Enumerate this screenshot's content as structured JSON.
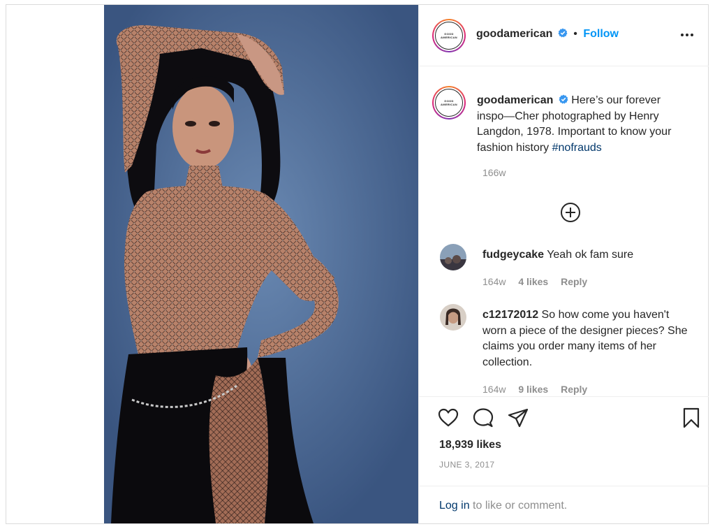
{
  "post": {
    "author": "goodamerican",
    "avatar_logo_line1": "GOOD",
    "avatar_logo_line2": "AMERICAN",
    "follow_label": "Follow",
    "separator": "•",
    "caption": "Here’s our forever inspo—Cher photographed by Henry Langdon, 1978. Important to know your fashion history",
    "hashtag": "#nofrauds",
    "caption_age": "166w",
    "likes": "18,939 likes",
    "date": "JUNE 3, 2017"
  },
  "comments": [
    {
      "user": "fudgeycake",
      "text": "Yeah ok fam sure",
      "age": "164w",
      "likes": "4 likes",
      "reply": "Reply"
    },
    {
      "user": "c12172012",
      "text": "So how come you haven't worn a piece of the designer pieces? She claims you order many items of her collection.",
      "age": "164w",
      "likes": "9 likes",
      "reply": "Reply"
    }
  ],
  "login": {
    "link": "Log in",
    "rest": "to like or comment."
  },
  "icons": {
    "verified": "verified-badge-icon",
    "more": "more-options-icon",
    "load_more": "plus-circle-icon",
    "like": "heart-icon",
    "comment": "comment-bubble-icon",
    "share": "paper-plane-icon",
    "save": "bookmark-icon"
  },
  "colors": {
    "accent": "#0095f6",
    "hashtag": "#00376b",
    "verified": "#3897f0",
    "muted": "#8e8e8e"
  }
}
